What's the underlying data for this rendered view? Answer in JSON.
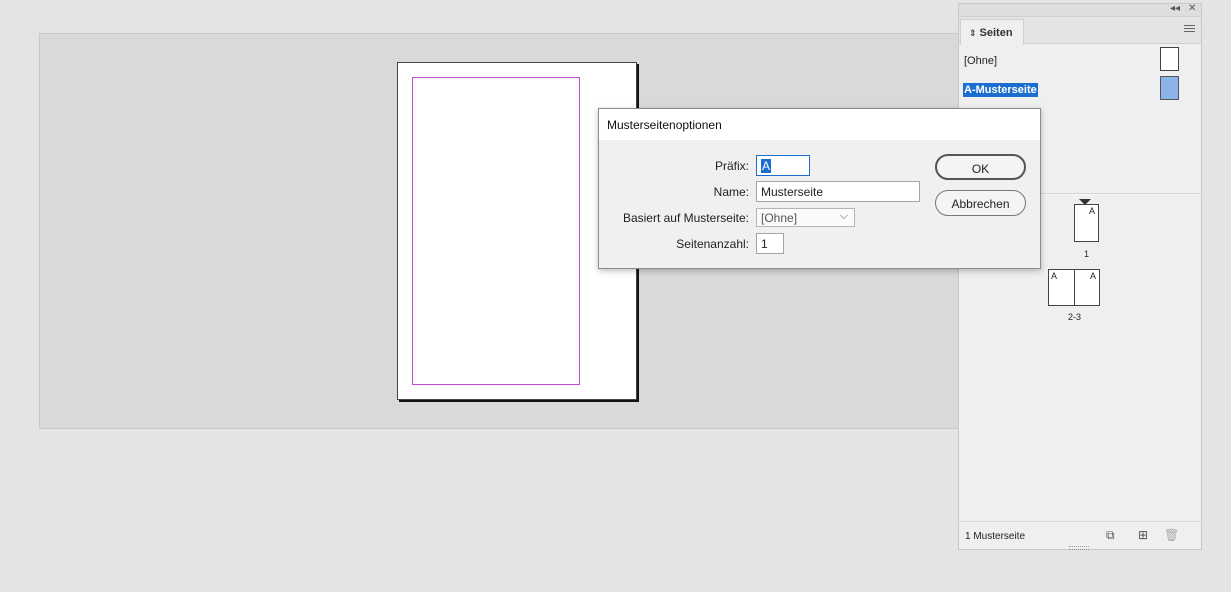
{
  "panel": {
    "collapse_icon": "◂◂",
    "close_icon": "✕",
    "tab_label": "Seiten",
    "tab_icon": "⇕",
    "masters": [
      {
        "label": "[Ohne]",
        "selected": false
      },
      {
        "label": "A-Musterseite",
        "selected": true
      }
    ],
    "pages": [
      {
        "number": "1",
        "labels": [
          "A"
        ]
      },
      {
        "number": "2-3",
        "labels": [
          "A",
          "A"
        ]
      }
    ],
    "footer": {
      "count": "1 Musterseite",
      "size_icon": "⧉",
      "new_page_icon": "⊞",
      "delete_icon": "🗑"
    }
  },
  "dialog": {
    "title": "Musterseitenoptionen",
    "prefix_label": "Präfix:",
    "prefix_value": "A",
    "name_label": "Name:",
    "name_value": "Musterseite",
    "based_on_label": "Basiert auf Musterseite:",
    "based_on_value": "[Ohne]",
    "page_count_label": "Seitenanzahl:",
    "page_count_value": "1",
    "ok_label": "OK",
    "cancel_label": "Abbrechen"
  },
  "colors": {
    "selection": "#1c6dd0",
    "margin_guide": "#c14ad6",
    "master_thumb_selected": "#8db3e8"
  }
}
